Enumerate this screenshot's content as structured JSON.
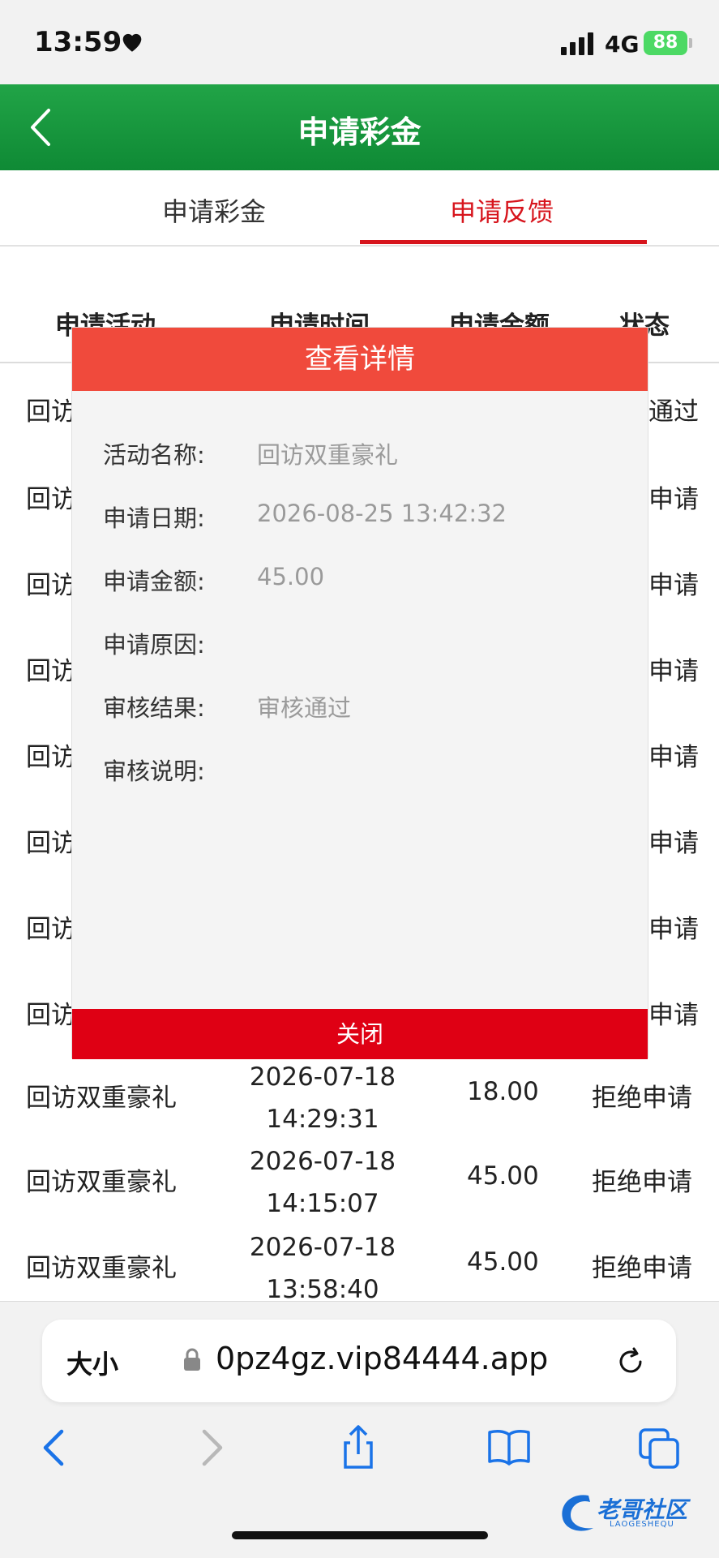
{
  "status_bar": {
    "time": "13:59",
    "network": "4G",
    "battery": "88"
  },
  "header": {
    "title": "申请彩金"
  },
  "tabs": [
    {
      "label": "申请彩金",
      "active": false
    },
    {
      "label": "申请反馈",
      "active": true
    }
  ],
  "table": {
    "headers": [
      "申请活动",
      "申请时间",
      "申请金额",
      "状态"
    ],
    "rows": [
      {
        "name": "回访",
        "date": "",
        "time": "",
        "amount": "",
        "status": "通过"
      },
      {
        "name": "回访",
        "date": "",
        "time": "",
        "amount": "",
        "status": "申请"
      },
      {
        "name": "回访",
        "date": "",
        "time": "",
        "amount": "",
        "status": "申请"
      },
      {
        "name": "回访",
        "date": "",
        "time": "",
        "amount": "",
        "status": "申请"
      },
      {
        "name": "回访",
        "date": "",
        "time": "",
        "amount": "",
        "status": "申请"
      },
      {
        "name": "回访",
        "date": "",
        "time": "",
        "amount": "",
        "status": "申请"
      },
      {
        "name": "回访",
        "date": "",
        "time": "",
        "amount": "",
        "status": "申请"
      },
      {
        "name": "回访",
        "date": "",
        "time": "",
        "amount": "",
        "status": "申请"
      },
      {
        "name": "回访双重豪礼",
        "date": "2026-07-18",
        "time": "14:29:31",
        "amount": "18.00",
        "status": "拒绝申请"
      },
      {
        "name": "回访双重豪礼",
        "date": "2026-07-18",
        "time": "14:15:07",
        "amount": "45.00",
        "status": "拒绝申请"
      },
      {
        "name": "回访双重豪礼",
        "date": "2026-07-18",
        "time": "13:58:40",
        "amount": "45.00",
        "status": "拒绝申请"
      }
    ]
  },
  "modal": {
    "title": "查看详情",
    "fields": [
      {
        "label": "活动名称:",
        "value": "回访双重豪礼"
      },
      {
        "label": "申请日期:",
        "value": "2026-08-25 13:42:32"
      },
      {
        "label": "申请金额:",
        "value": "45.00"
      },
      {
        "label": "申请原因:",
        "value": ""
      },
      {
        "label": "审核结果:",
        "value": "审核通过"
      },
      {
        "label": "审核说明:",
        "value": ""
      }
    ],
    "close_label": "关闭"
  },
  "browser": {
    "text_size_label": "大小",
    "url": "0pz4gz.vip84444.app"
  },
  "watermark": {
    "text": "老哥社区",
    "sub": "LAOGESHEQU"
  },
  "colors": {
    "header_green": "#17963d",
    "accent_red": "#d7151d",
    "modal_header": "#f04a3c",
    "close_red": "#df0014"
  }
}
